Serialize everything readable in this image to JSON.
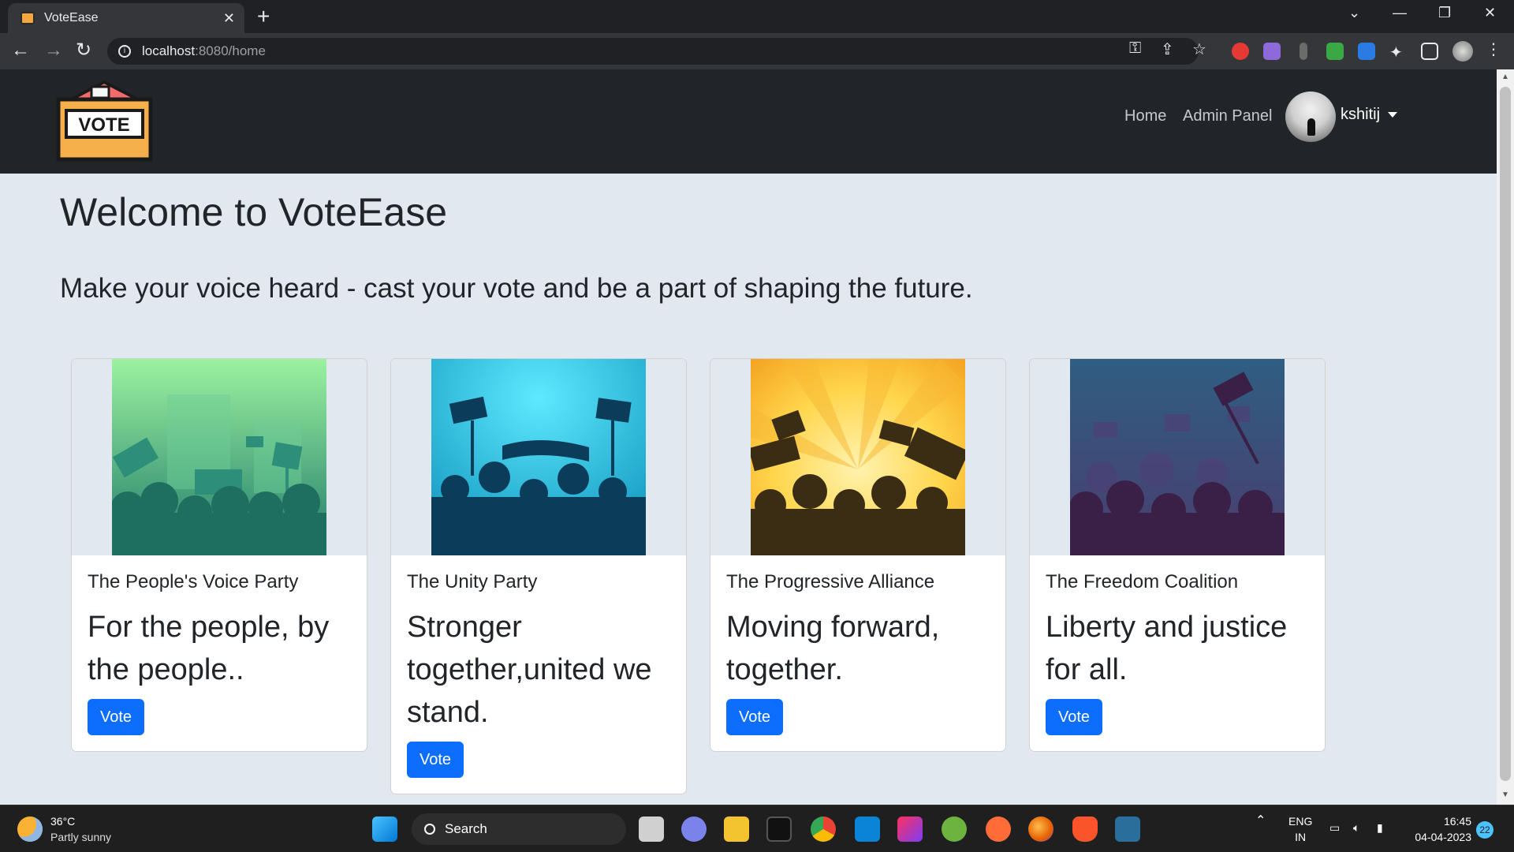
{
  "browser": {
    "tab_title": "VoteEase",
    "url_host": "localhost",
    "url_path": ":8080/home"
  },
  "navbar": {
    "logo_text": "VOTE",
    "links": [
      "Home",
      "Admin Panel"
    ],
    "username": "kshitij"
  },
  "main": {
    "heading": "Welcome to VoteEase",
    "lead": "Make your voice heard - cast your vote and be a part of shaping the future."
  },
  "cards": [
    {
      "title": "The People's Voice Party",
      "text": "For the people, by the people..",
      "button": "Vote",
      "bg_top": "#9cf29f",
      "bg_bottom": "#1e7a6a",
      "crowd": "#2d8f79"
    },
    {
      "title": "The Unity Party",
      "text": "Stronger together,united we stand.",
      "button": "Vote",
      "bg_top": "#1fd1f0",
      "bg_bottom": "#0a8fb8",
      "crowd": "#0b3d5a"
    },
    {
      "title": "The Progressive Alliance",
      "text": "Moving forward, together.",
      "button": "Vote",
      "bg_top": "#ffd54a",
      "bg_bottom": "#f29a1a",
      "crowd": "#3b2d14"
    },
    {
      "title": "The Freedom Coalition",
      "text": "Liberty and justice for all.",
      "button": "Vote",
      "bg_top": "#2f5e82",
      "bg_bottom": "#4a3d6e",
      "crowd": "#3a1f47"
    }
  ],
  "taskbar": {
    "temperature": "36°C",
    "condition": "Partly sunny",
    "search_placeholder": "Search",
    "lang_top": "ENG",
    "lang_bottom": "IN",
    "time": "16:45",
    "date": "04-04-2023",
    "notification_count": "22"
  },
  "colors": {
    "primary_button": "#0d6efd",
    "navbar_bg": "#212529",
    "page_bg": "#e2e8f0"
  }
}
